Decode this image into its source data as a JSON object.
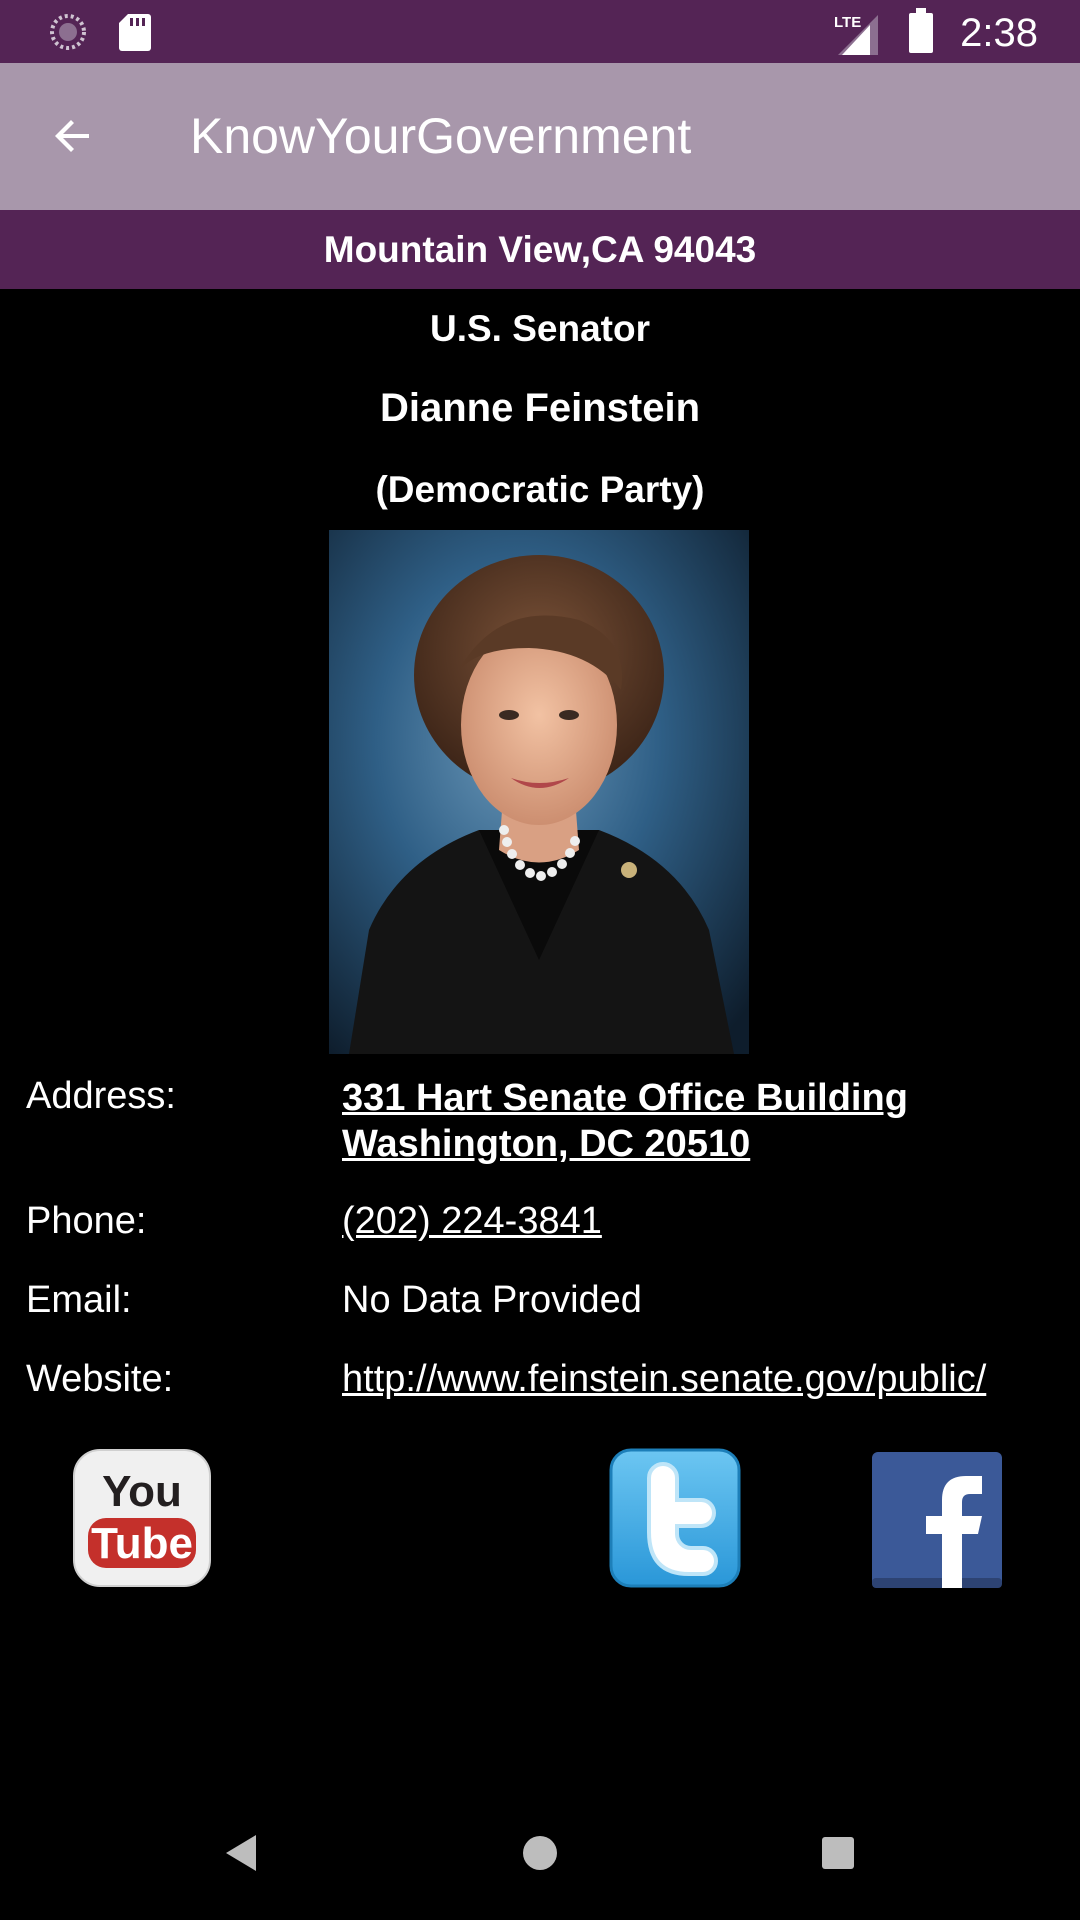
{
  "status_bar": {
    "time": "2:38",
    "network": "LTE",
    "icons": [
      "sync-icon",
      "sd-card-icon",
      "signal-icon",
      "battery-icon"
    ]
  },
  "app_bar": {
    "title": "KnowYourGovernment",
    "back_icon": "arrow-back-icon"
  },
  "location": "Mountain View,CA 94043",
  "official": {
    "office": "U.S. Senator",
    "name": "Dianne Feinstein",
    "party": "(Democratic Party)"
  },
  "details": {
    "address_label": "Address:",
    "address_line1": "331 Hart Senate Office Building",
    "address_line2": "Washington, DC 20510",
    "phone_label": "Phone:",
    "phone": "(202) 224-3841",
    "email_label": "Email:",
    "email": "No Data Provided",
    "website_label": "Website:",
    "website": "http://www.feinstein.senate.gov/public/"
  },
  "social": {
    "youtube_you": "You",
    "youtube_tube": "Tube",
    "icons": [
      "youtube-icon",
      "twitter-icon",
      "facebook-icon"
    ]
  },
  "colors": {
    "status_bar": "#542455",
    "app_bar": "#a897ab",
    "location_bar": "#542455",
    "background": "#000000",
    "youtube_red": "#c4302b",
    "twitter_blue": "#4ab3e8",
    "facebook_blue": "#3b5998"
  }
}
